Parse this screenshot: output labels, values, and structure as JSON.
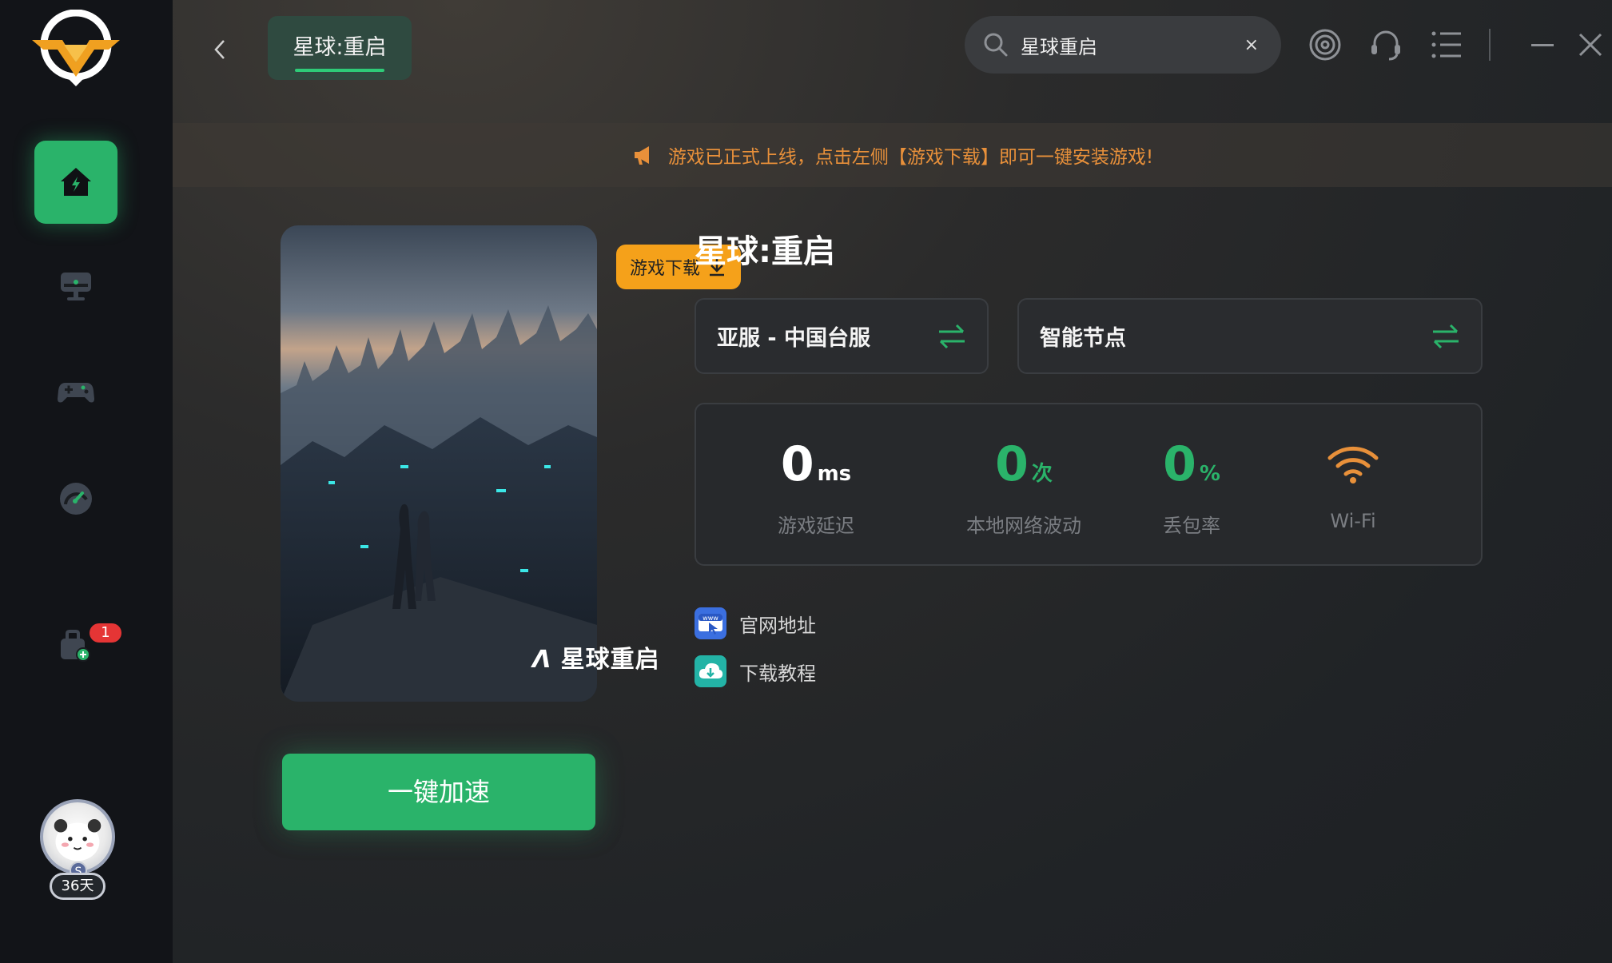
{
  "colors": {
    "accent": "#2ab36a",
    "warning": "#e8903a",
    "download": "#f5a11a",
    "badge": "#e53535"
  },
  "sidebar": {
    "items": [
      {
        "name": "home",
        "icon": "home-icon",
        "active": true
      },
      {
        "name": "monitor",
        "icon": "monitor-icon"
      },
      {
        "name": "gamepad",
        "icon": "gamepad-icon"
      },
      {
        "name": "speed",
        "icon": "speedometer-icon"
      },
      {
        "name": "toolbox",
        "icon": "toolbox-icon",
        "badge": "1"
      }
    ],
    "user": {
      "days": "36天",
      "level": "S"
    }
  },
  "header": {
    "tab_title": "星球:重启",
    "search": {
      "value": "星球重启",
      "clear": "×"
    }
  },
  "notice": {
    "text": "游戏已正式上线，点击左侧【游戏下载】即可一键安装游戏!"
  },
  "game": {
    "cover_title": "星球重启",
    "download_label": "游戏下载",
    "title": "星球:重启",
    "accelerate_label": "一键加速",
    "server": "亚服 - 中国台服",
    "node": "智能节点",
    "stats": [
      {
        "value": "0",
        "unit": "ms",
        "label": "游戏延迟",
        "color": "#ffffff"
      },
      {
        "value": "0",
        "unit": "次",
        "label": "本地网络波动",
        "color": "#2ab36a"
      },
      {
        "value": "0",
        "unit": "%",
        "label": "丢包率",
        "color": "#2ab36a"
      },
      {
        "label": "Wi-Fi",
        "color": "#e8903a"
      }
    ],
    "links": [
      {
        "label": "官网地址",
        "icon": "www-icon"
      },
      {
        "label": "下载教程",
        "icon": "cloud-download-icon"
      }
    ]
  }
}
